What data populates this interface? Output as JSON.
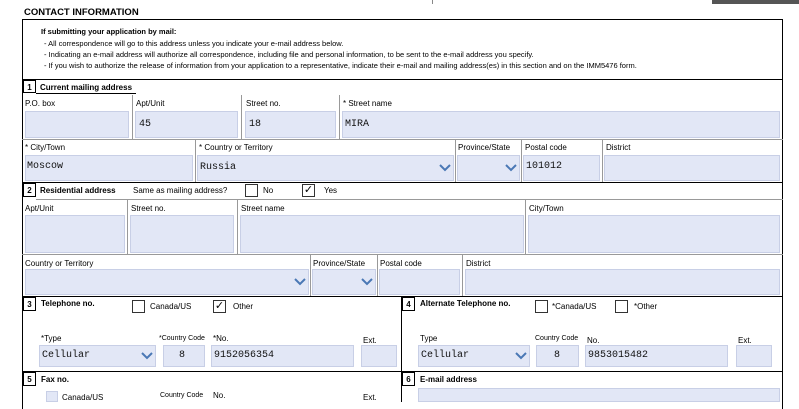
{
  "header": {
    "title": "CONTACT INFORMATION"
  },
  "instructions": {
    "heading": "If submitting your application by mail:",
    "bullets": [
      "- All correspondence will go to this address unless you indicate your e-mail address below.",
      "- Indicating an e-mail address will authorize all correspondence, including file and personal information, to be sent to the e-mail address you specify.",
      "- If you wish to authorize the release of information from your application to a representative, indicate their e-mail and mailing address(es) in this section and on the IMM5476 form."
    ]
  },
  "mailing": {
    "number": "1",
    "title": "Current mailing address",
    "po_box_label": "P.O. box",
    "po_box": "",
    "apt_label": "Apt/Unit",
    "apt": "45",
    "street_no_label": "Street no.",
    "street_no": "18",
    "street_name_label": "* Street name",
    "street_name": "MIRA",
    "city_label": "* City/Town",
    "city": "Moscow",
    "country_label": "* Country or Territory",
    "country": "Russia",
    "province_label": "Province/State",
    "province": "",
    "postal_label": "Postal code",
    "postal": "101012",
    "district_label": "District",
    "district": ""
  },
  "residential": {
    "number": "2",
    "title": "Residential address",
    "same_question": "Same as mailing address?",
    "no_label": "No",
    "yes_label": "Yes",
    "checkmark": "✓",
    "apt_label": "Apt/Unit",
    "street_no_label": "Street no.",
    "street_name_label": "Street name",
    "city_label": "City/Town",
    "country_label": "Country or Territory",
    "province_label": "Province/State",
    "postal_label": "Postal code",
    "district_label": "District"
  },
  "telephone": {
    "number": "3",
    "title": "Telephone no.",
    "canada_label": "Canada/US",
    "other_label": "Other",
    "checkmark": "✓",
    "type_label": "*Type",
    "type": "Cellular",
    "cc_label": "*Country Code",
    "cc": "8",
    "no_label": "*No.",
    "no": "9152056354",
    "ext_label": "Ext.",
    "ext": ""
  },
  "alt_telephone": {
    "number": "4",
    "title": "Alternate Telephone no.",
    "canada_label": "*Canada/US",
    "other_label": "*Other",
    "type_label": "Type",
    "type": "Cellular",
    "cc_label": "Country Code",
    "cc": "8",
    "no_label": "No.",
    "no": "9853015482",
    "ext_label": "Ext.",
    "ext": ""
  },
  "fax": {
    "number": "5",
    "title": "Fax no.",
    "canada_label": "Canada/US",
    "cc_label": "Country Code",
    "no_label": "No.",
    "ext_label": "Ext."
  },
  "email": {
    "number": "6",
    "title": "E-mail address"
  }
}
